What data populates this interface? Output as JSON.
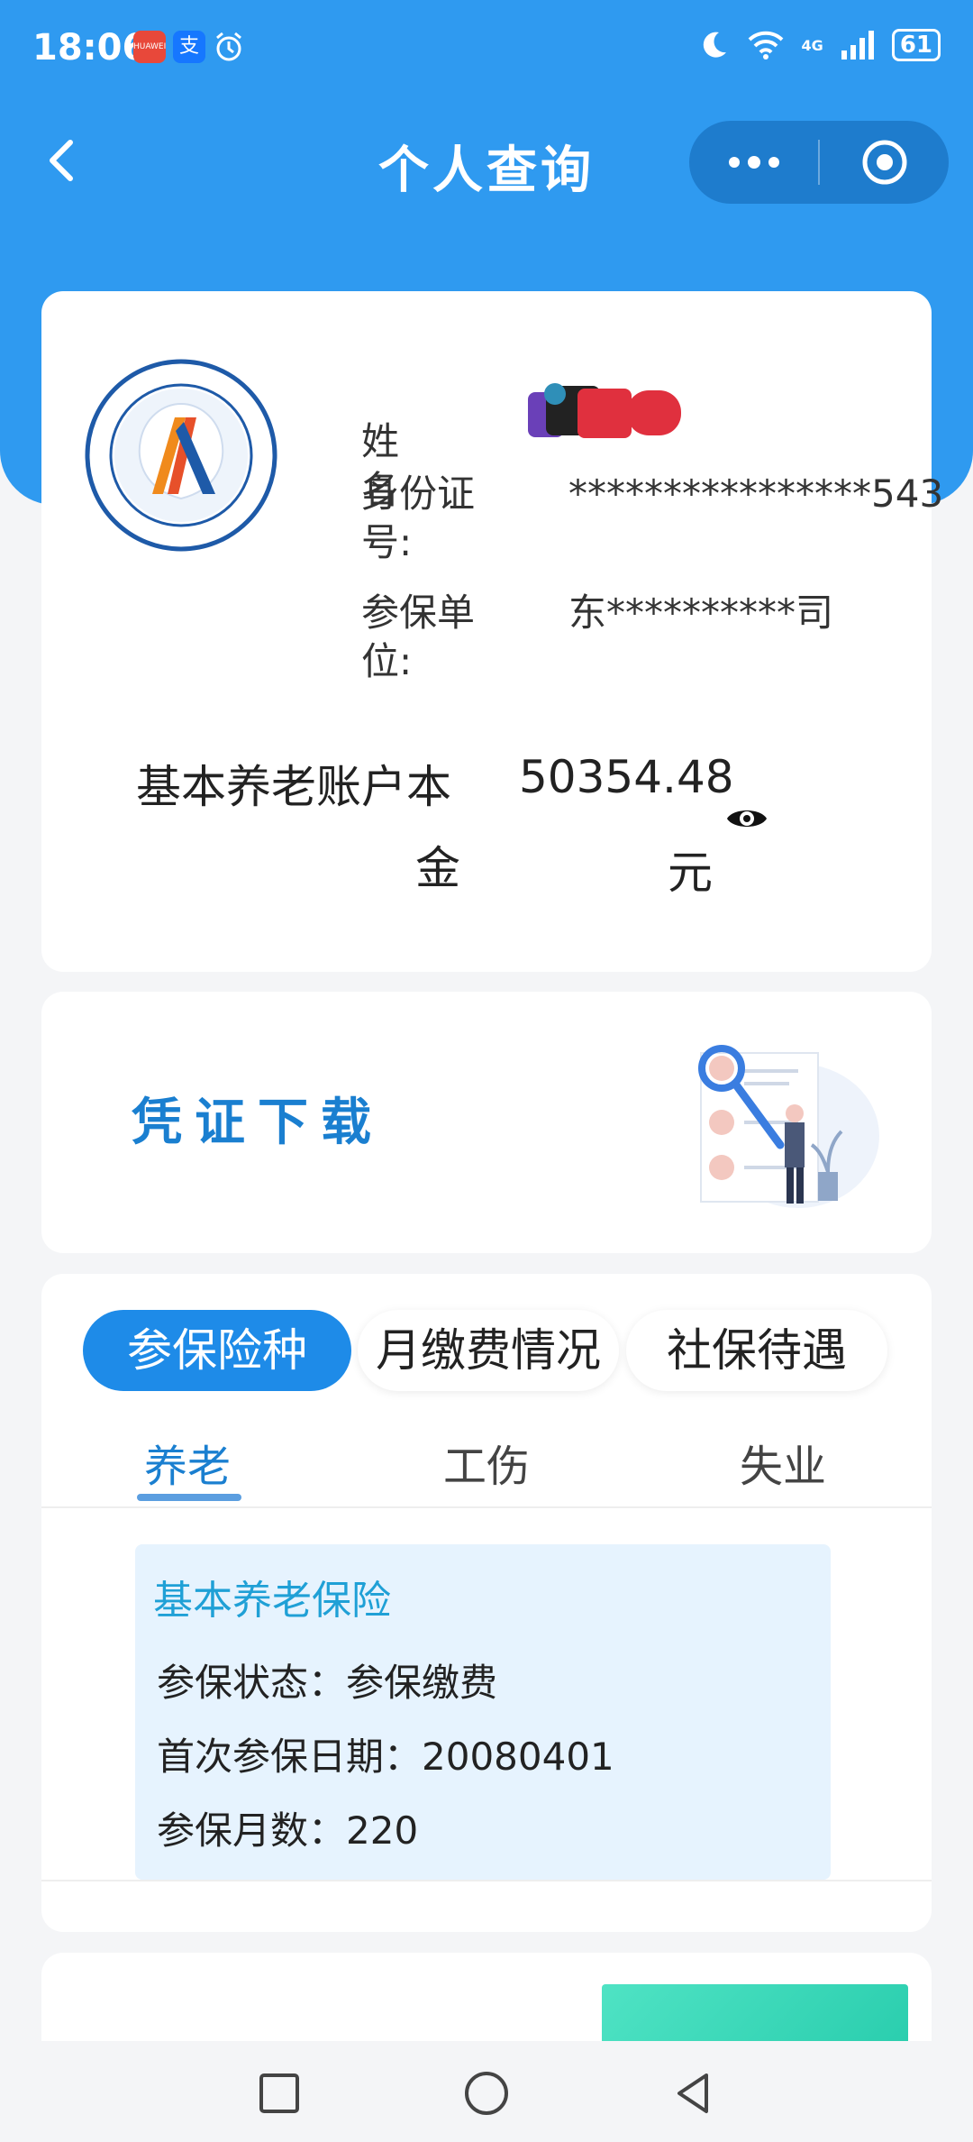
{
  "status_bar": {
    "time": "18:06",
    "app1": "HUAWEI",
    "app2": "支",
    "network": "4G",
    "battery": "61"
  },
  "nav": {
    "title": "个人查询"
  },
  "info": {
    "name_label": "姓　　名",
    "id_label": "身份证号:",
    "id_value": "****************543",
    "unit_label": "参保单位:",
    "unit_value": "东**********司",
    "balance_label_1": "基本养老账户本",
    "balance_label_2": "金",
    "balance_value": "50354.48",
    "balance_unit": "元"
  },
  "voucher": {
    "label": "凭证下载"
  },
  "tabs": {
    "pills": [
      "参保险种",
      "月缴费情况",
      "社保待遇"
    ],
    "subtabs": [
      "养老",
      "工伤",
      "失业"
    ]
  },
  "panel": {
    "title": "基本养老保险",
    "status": "参保状态：参保缴费",
    "first_date": "首次参保日期：20080401",
    "months": "参保月数：220"
  },
  "colors": {
    "primary_blue": "#2f9af0",
    "active_tab": "#1e8be8",
    "panel_bg": "#e6f3fe",
    "panel_title": "#1fa0d6"
  }
}
